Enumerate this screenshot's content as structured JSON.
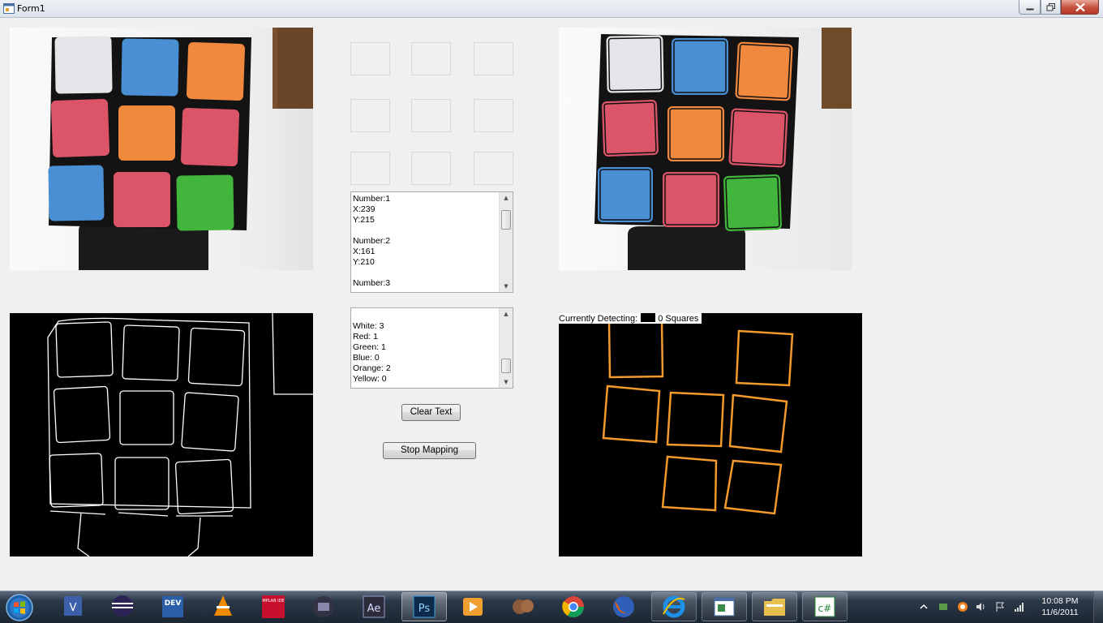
{
  "window": {
    "title": "Form1"
  },
  "coords_box": {
    "lines": [
      "Number:1",
      "X:239",
      "Y:215",
      "",
      "Number:2",
      "X:161",
      "Y:210",
      "",
      "Number:3"
    ]
  },
  "color_counts": {
    "lines": [
      "",
      "White: 3",
      "Red: 1",
      "Green: 1",
      "Blue: 0",
      "Orange: 2",
      "Yellow: 0"
    ]
  },
  "buttons": {
    "clear_text": "Clear Text",
    "stop_mapping": "Stop Mapping"
  },
  "detection": {
    "label": "Currently Detecting:",
    "count_text": "0 Squares",
    "square_color": "#f39a2c"
  },
  "cube_colors": {
    "white": "#e6e6ea",
    "blue": "#4a8fd4",
    "orange": "#f0883e",
    "red": "#dc5468",
    "green": "#41b53c"
  },
  "cube_face": [
    [
      "white",
      "blue",
      "orange"
    ],
    [
      "red",
      "orange",
      "red"
    ],
    [
      "blue",
      "red",
      "green"
    ]
  ],
  "taskbar": {
    "start": "start-orb-icon",
    "apps": [
      "vs4-icon",
      "eclipse-icon",
      "devcpp-icon",
      "vlc-icon",
      "mplab-ide-icon",
      "remote-icon",
      "after-effects-icon",
      "photoshop-icon",
      "media-player-icon",
      "cookies-icon",
      "chrome-icon",
      "firefox-icon",
      "internet-explorer-icon",
      "form-app-icon",
      "file-explorer-icon",
      "csharp-icon"
    ],
    "ae_label": "Ae",
    "ps_label": "Ps",
    "dev_label": "DEV",
    "cs_label": "c#",
    "mplab_label": "MPLAB IDE",
    "clock_time": "10:08 PM",
    "clock_date": "11/6/2011"
  }
}
